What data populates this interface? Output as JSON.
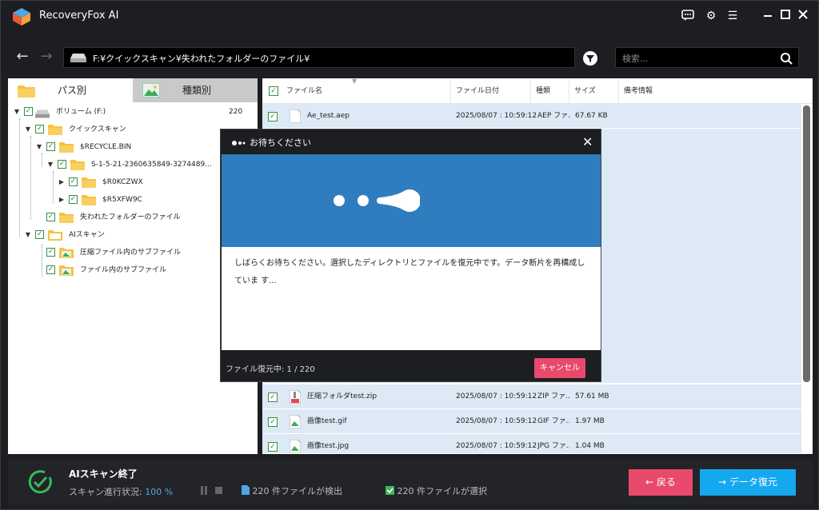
{
  "app": {
    "title": "RecoveryFox AI"
  },
  "nav": {
    "path": "F:¥クイックスキャン¥失われたフォルダーのファイル¥",
    "search_placeholder": "検索..."
  },
  "left_tabs": [
    {
      "label": "パス別"
    },
    {
      "label": "種類別"
    }
  ],
  "tree": {
    "volume": {
      "label": "ボリューム (F:)",
      "count": "220"
    },
    "quick": "クイックスキャン",
    "recycle": "$RECYCLE.BIN",
    "sid": "S-1-5-21-2360635849-3274489...",
    "r1": "$R0KCZWX",
    "r2": "$R5XFW9C",
    "lost": "失われたフォルダーのファイル",
    "ai": "AIスキャン",
    "zipsub": "圧縮ファイル内のサブファイル",
    "filesub": "ファイル内のサブファイル"
  },
  "table": {
    "headers": [
      "ファイル名",
      "ファイル日付",
      "種類",
      "サイズ",
      "備考情報"
    ],
    "rows": [
      {
        "name": "Ae_test.aep",
        "date": "2025/08/07 : 10:59:12",
        "type": "AEP ファ...",
        "size": "67.67 KB"
      },
      {
        "name": "圧縮フォルダtest.zip",
        "date": "2025/08/07 : 10:59:12",
        "type": "ZIP ファ...",
        "size": "57.61 MB"
      },
      {
        "name": "画像test.gif",
        "date": "2025/08/07 : 10:59:12",
        "type": "GIF ファ...",
        "size": "1.97 MB"
      },
      {
        "name": "画像test.jpg",
        "date": "2025/08/07 : 10:59:12",
        "type": "JPG ファ...",
        "size": "1.04 MB"
      }
    ]
  },
  "dialog": {
    "title": "お待ちください",
    "message": "しばらくお待ちください。選択したディレクトリとファイルを復元中です。データ断片を再構成していま す...",
    "progress": "ファイル復元中: 1 / 220",
    "cancel": "キャンセル"
  },
  "bottom": {
    "scan_done": "AIスキャン終了",
    "scan_label": "スキャン進行状況:",
    "scan_pct": "100 %",
    "found": "220 件ファイルが検出",
    "selected": "220 件ファイルが選択",
    "back": "戻る",
    "recover": "データ復元"
  },
  "colors": {
    "accent": "#14a8ee",
    "cancel": "#e9496b",
    "banner": "#2f7dbe",
    "check": "#3a8f48"
  }
}
